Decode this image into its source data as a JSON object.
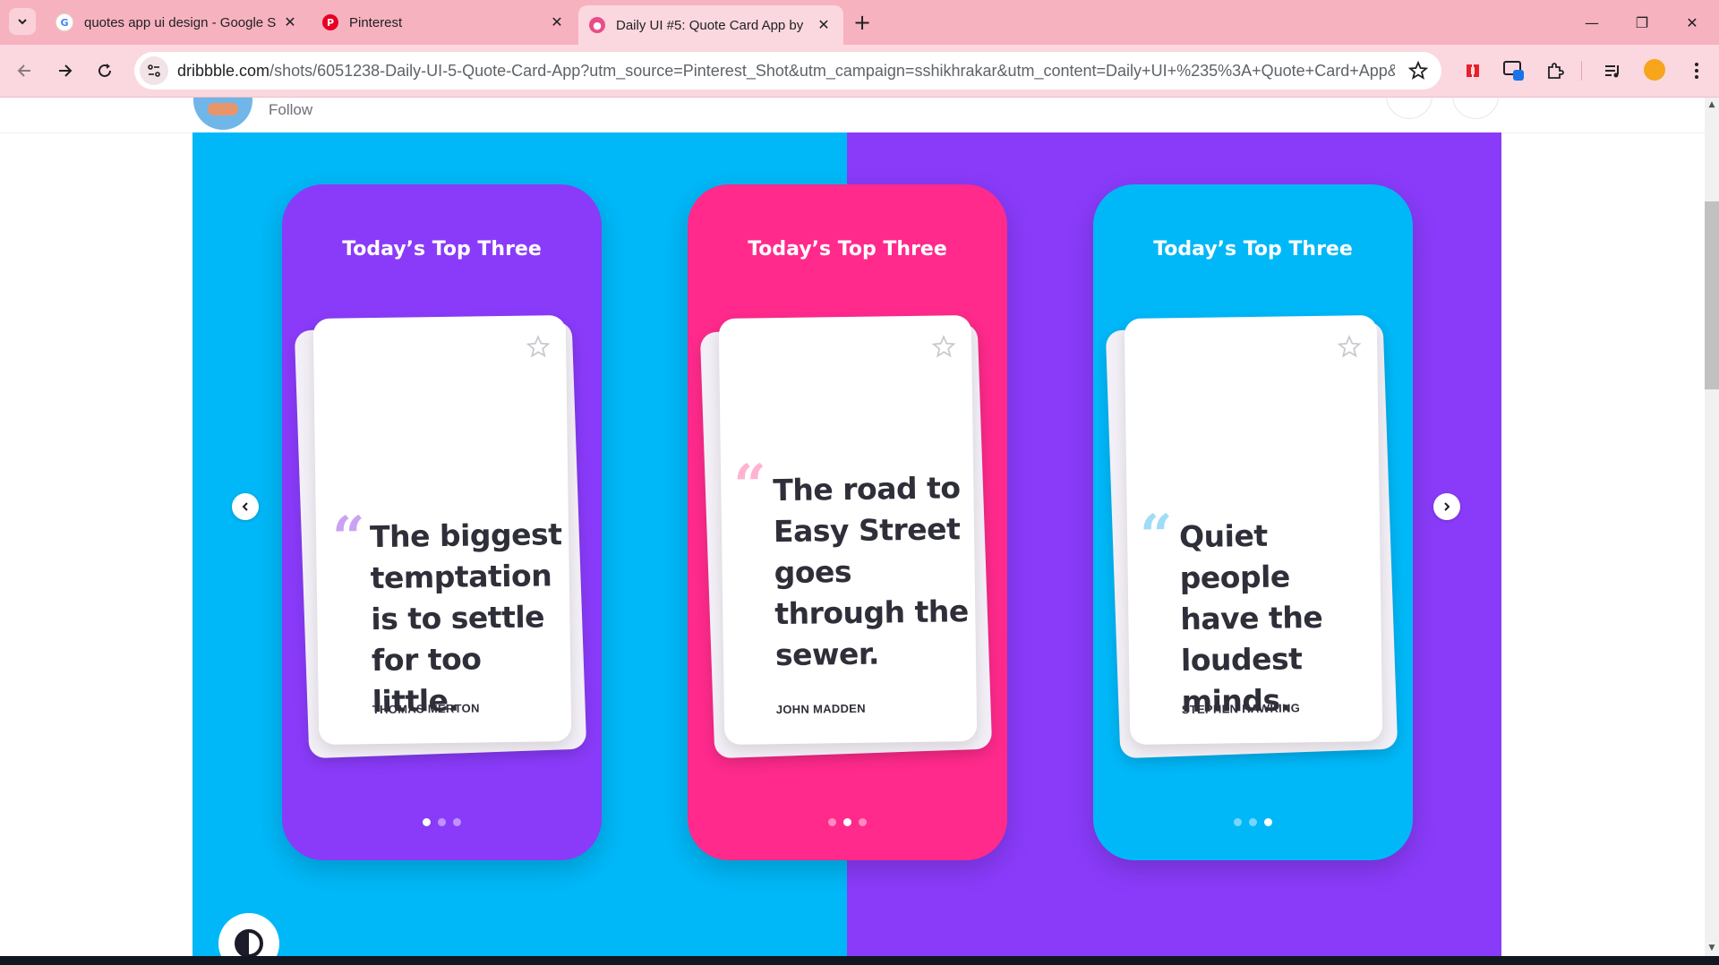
{
  "browser": {
    "tabs": [
      {
        "title": "quotes app ui design - Google S",
        "favicon": "google-icon",
        "active": false
      },
      {
        "title": "Pinterest",
        "favicon": "pinterest-icon",
        "active": false
      },
      {
        "title": "Daily UI #5: Quote Card App by",
        "favicon": "dribbble-icon",
        "active": true
      }
    ],
    "url_host": "dribbble.com",
    "url_rest": "/shots/6051238-Daily-UI-5-Quote-Card-App?utm_source=Pinterest_Shot&utm_campaign=sshikhrakar&utm_content=Daily+UI+%235%3A+Quote+Card+App&ut...",
    "colors": {
      "tabbar": "#f7b2bf",
      "toolbar": "#fbd8df"
    }
  },
  "page": {
    "follow_label": "Follow"
  },
  "shot": {
    "colors": {
      "left_bg": "#00b8f8",
      "right_bg": "#8a3bfa"
    },
    "screens": [
      {
        "heading": "Today’s Top Three",
        "quote": "The biggest temptation is to settle for too little.",
        "author": "THOMAS MERTON",
        "bg": "#8a3bfa",
        "quote_mark_color": "#c9a2f2",
        "active_dot": 1
      },
      {
        "heading": "Today’s Top Three",
        "quote": "The road to Easy Street goes through the sewer.",
        "author": "JOHN MADDEN",
        "bg": "#ff2a8c",
        "quote_mark_color": "#ffb3d1",
        "active_dot": 2
      },
      {
        "heading": "Today’s Top Three",
        "quote": "Quiet people have the loudest minds.",
        "author": "STEPHEN HAWKING",
        "bg": "#00b8f8",
        "quote_mark_color": "#9fdcf7",
        "active_dot": 3
      }
    ]
  }
}
